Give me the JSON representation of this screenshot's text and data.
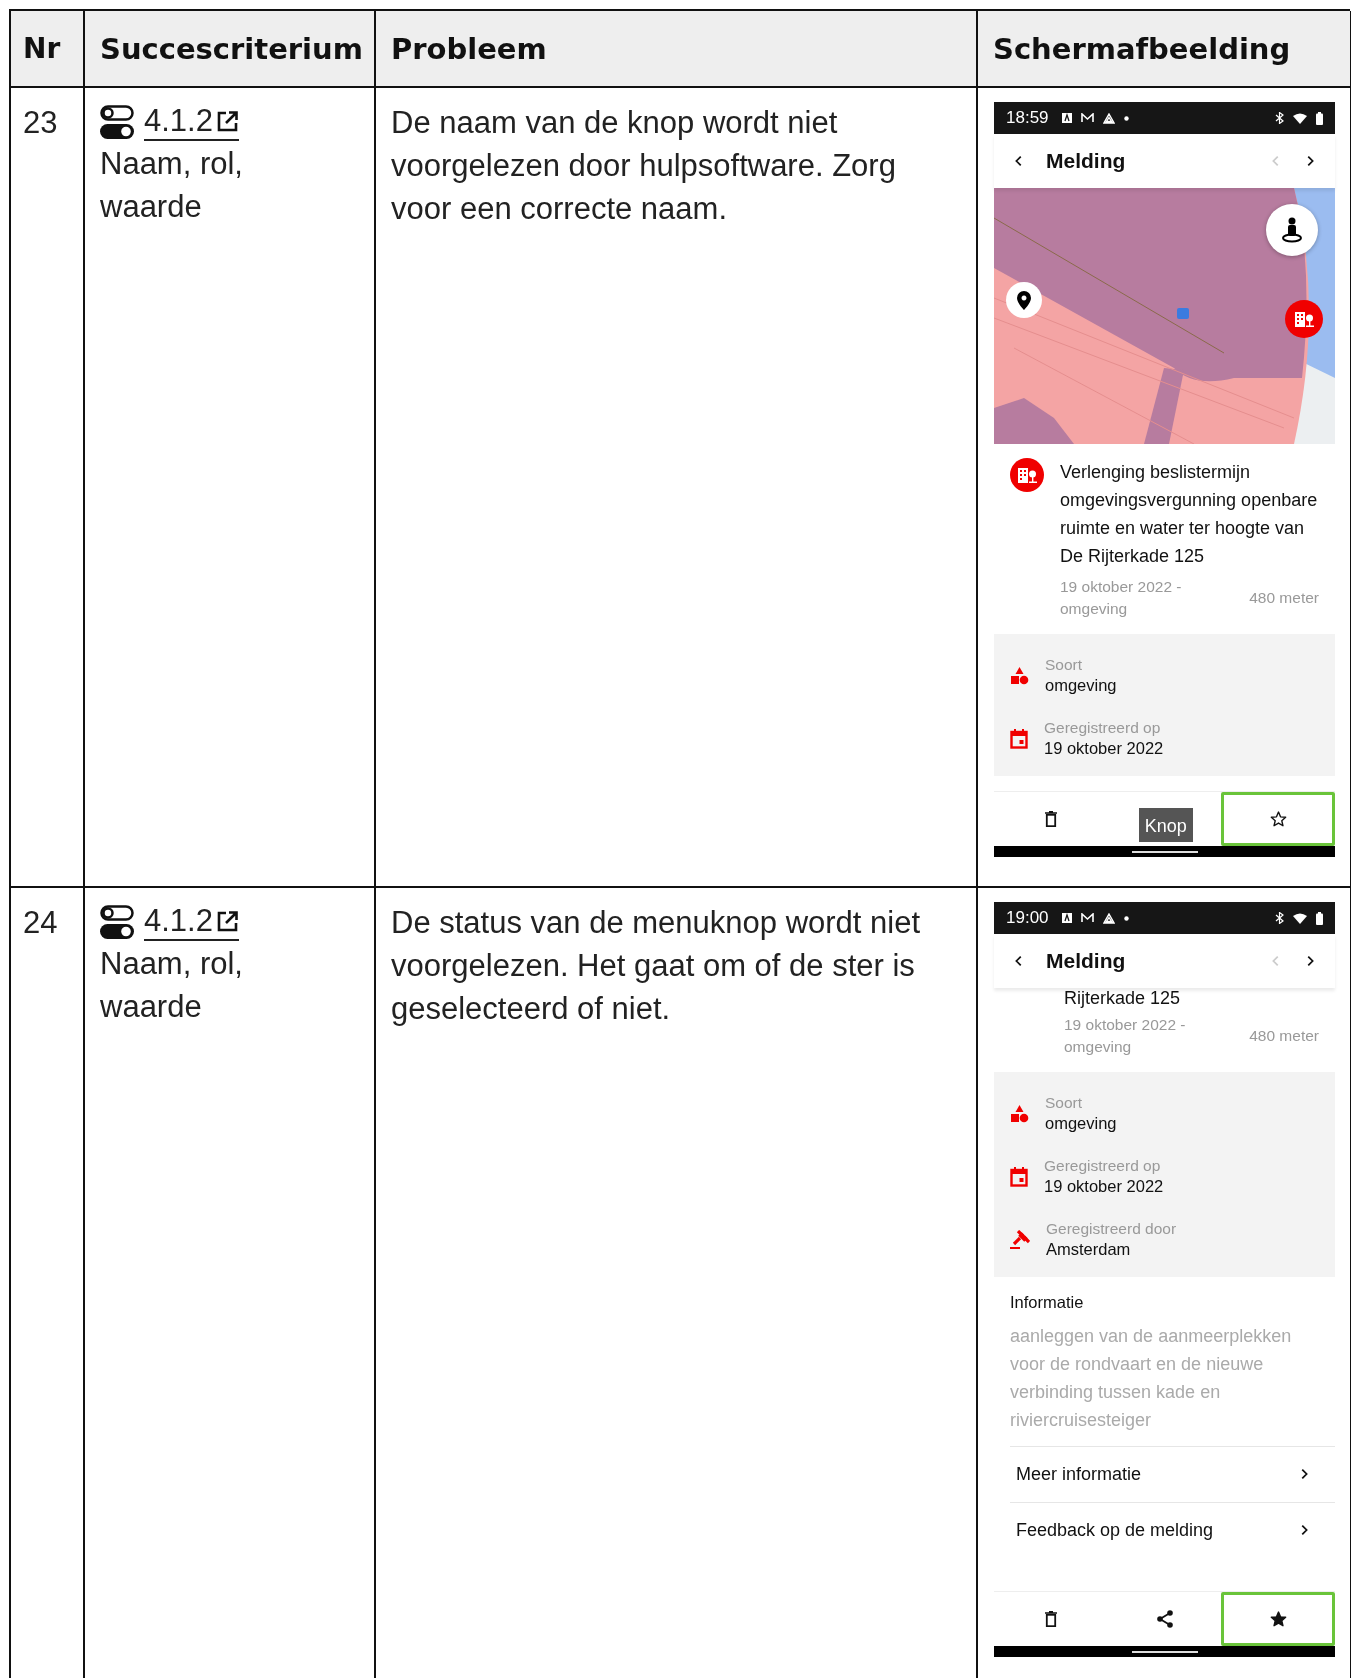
{
  "table": {
    "columns": [
      "Nr",
      "Succescriterium",
      "Probleem",
      "Schermafbeelding"
    ],
    "rows": [
      {
        "nr": "23",
        "criterion": {
          "code": "4.1.2",
          "name": "Naam, rol, waarde"
        },
        "problem": "De naam van de knop wordt niet voorgelezen door hulpsoftware. Zorg voor een correcte naam.",
        "screenshot": {
          "time": "18:59",
          "title": "Melding",
          "content": [
            {
              "kind": "map"
            },
            {
              "kind": "notice",
              "title": "Verlenging beslistermijn omgevingsvergunning openbare ruimte en water ter hoogte van De Rijterkade 125",
              "meta": "19 oktober 2022 - omgeving",
              "distance": "480 meter"
            },
            {
              "kind": "details",
              "items": [
                {
                  "kind": "category",
                  "label": "Soort",
                  "value": "omgeving"
                },
                {
                  "kind": "date",
                  "label": "Geregistreerd op",
                  "value": "19 oktober 2022"
                }
              ]
            }
          ],
          "bar": {
            "delete": {
              "highlighted": false
            },
            "share": {
              "highlighted": false,
              "tooltip": "Knop"
            },
            "star": {
              "highlighted": true,
              "filled": false
            }
          }
        }
      },
      {
        "nr": "24",
        "criterion": {
          "code": "4.1.2",
          "name": "Naam, rol, waarde"
        },
        "problem": "De status van de menuknop wordt niet voorgelezen. Het gaat om of de ster is geselecteerd of niet.",
        "screenshot": {
          "time": "19:00",
          "title": "Melding",
          "content": [
            {
              "kind": "notice_tail",
              "title": "Rijterkade 125",
              "meta": "19 oktober 2022 - omgeving",
              "distance": "480 meter"
            },
            {
              "kind": "details",
              "items": [
                {
                  "kind": "category",
                  "label": "Soort",
                  "value": "omgeving"
                },
                {
                  "kind": "date",
                  "label": "Geregistreerd op",
                  "value": "19 oktober 2022"
                },
                {
                  "kind": "authority",
                  "label": "Geregistreerd door",
                  "value": "Amsterdam"
                }
              ]
            },
            {
              "kind": "info",
              "heading": "Informatie",
              "text": "aanleggen van de aanmeerplekken voor de rondvaart en de nieuwe verbinding tussen kade en riviercruisesteiger"
            },
            {
              "kind": "links",
              "items": [
                "Meer informatie",
                "Feedback op de melding"
              ]
            }
          ],
          "bar": {
            "delete": {
              "highlighted": false
            },
            "share": {
              "highlighted": false
            },
            "star": {
              "highlighted": true,
              "filled": true
            }
          }
        }
      }
    ]
  }
}
